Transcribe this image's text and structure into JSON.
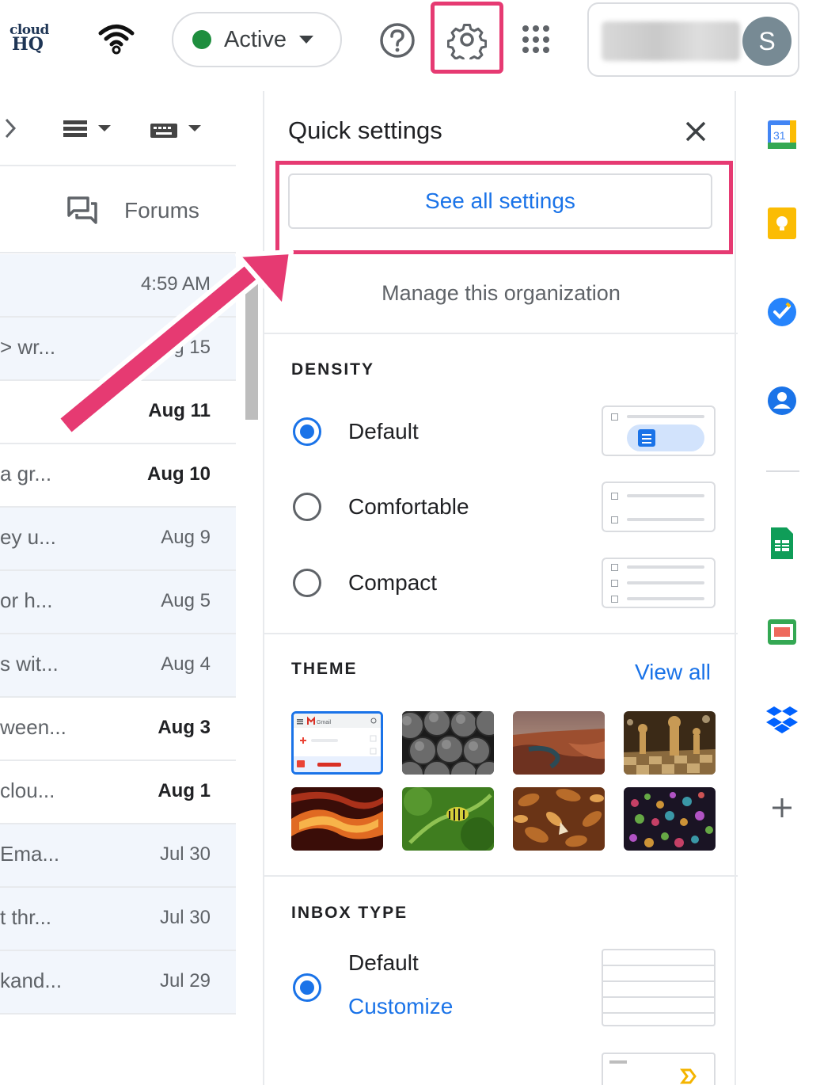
{
  "topbar": {
    "logo": {
      "line1": "cloud",
      "line2": "HQ"
    },
    "status": {
      "label": "Active",
      "color": "#1e8e3e"
    },
    "account": {
      "avatar_letter": "S"
    }
  },
  "left": {
    "tab_forums": "Forums",
    "rows": [
      {
        "snippet": "",
        "date": "4:59 AM",
        "unread": false
      },
      {
        "snippet": "> wr...",
        "date": "Aug 15",
        "unread": false
      },
      {
        "snippet": "",
        "date": "Aug 11",
        "unread": true
      },
      {
        "snippet": "a gr...",
        "date": "Aug 10",
        "unread": true
      },
      {
        "snippet": "ey u...",
        "date": "Aug 9",
        "unread": false
      },
      {
        "snippet": "or h...",
        "date": "Aug 5",
        "unread": false
      },
      {
        "snippet": "s wit...",
        "date": "Aug 4",
        "unread": false
      },
      {
        "snippet": "ween...",
        "date": "Aug 3",
        "unread": true
      },
      {
        "snippet": "clou...",
        "date": "Aug 1",
        "unread": true
      },
      {
        "snippet": "Ema...",
        "date": "Jul 30",
        "unread": false
      },
      {
        "snippet": "t thr...",
        "date": "Jul 30",
        "unread": false
      },
      {
        "snippet": "kand...",
        "date": "Jul 29",
        "unread": false
      }
    ]
  },
  "quick_settings": {
    "title": "Quick settings",
    "see_all": "See all settings",
    "manage_org": "Manage this organization",
    "density": {
      "heading": "DENSITY",
      "options": [
        {
          "label": "Default",
          "checked": true
        },
        {
          "label": "Comfortable",
          "checked": false
        },
        {
          "label": "Compact",
          "checked": false
        }
      ]
    },
    "theme": {
      "heading": "THEME",
      "view_all": "View all",
      "thumb_gmail_label": "Gmail",
      "themes": [
        "default",
        "pipes",
        "canyon",
        "chess",
        "sandstone",
        "caterpillar",
        "leaves",
        "bokeh"
      ]
    },
    "inbox_type": {
      "heading": "INBOX TYPE",
      "selected": "Default",
      "customize": "Customize"
    }
  },
  "colors": {
    "accent": "#1a73e8",
    "highlight": "#e63a72",
    "arrow": "#e63a72"
  }
}
